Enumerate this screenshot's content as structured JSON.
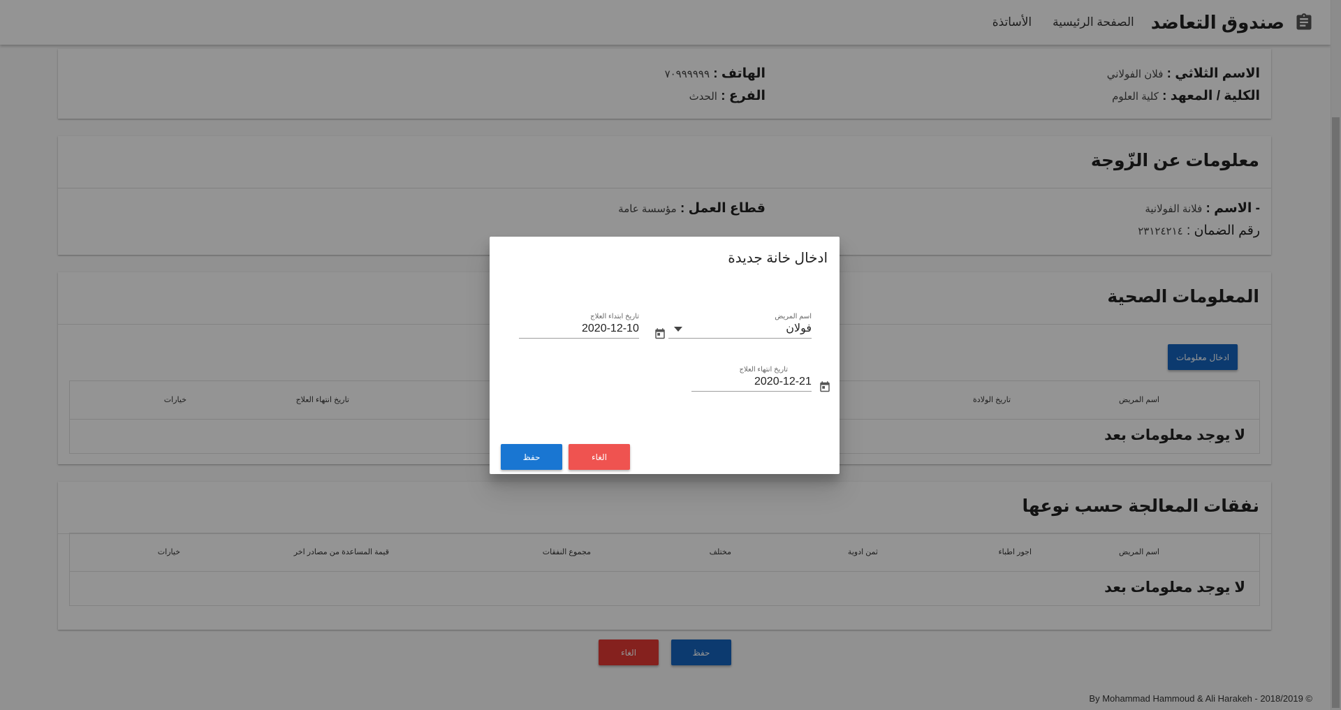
{
  "appbar": {
    "brand": "صندوق التعاضد",
    "nav": [
      "الصفحة الرئيسية",
      "الأساتذة"
    ]
  },
  "profile": {
    "name_label": "الاسم الثلاثي : ",
    "name_value": "فلان الفولاني",
    "faculty_label": "الكلية / المعهد : ",
    "faculty_value": "كلية العلوم",
    "phone_label": "الهاتف : ",
    "phone_value": "٧٠٩٩٩٩٩٩",
    "branch_label": "الفرع : ",
    "branch_value": "الحدث"
  },
  "spouse": {
    "title": "معلومات عن الزّوجة",
    "name_label": "- الاسم : ",
    "name_value": "فلانة الفولانية",
    "sector_label": "قطاع العمل : ",
    "sector_value": "مؤسسة عامة",
    "insurance_label": "رقم الضمان : ",
    "insurance_value": "٢٣١٢٤٢١٤"
  },
  "health": {
    "title": "المعلومات الصحية",
    "add_button": "ادخال معلومات",
    "columns": [
      "اسم المريض",
      "تاريخ الولادة",
      "تاريخ انتهاء العلاج",
      "خيارات"
    ],
    "empty": "لا يوجد معلومات بعد"
  },
  "expenses": {
    "title": "نفقات المعالجة حسب نوعها",
    "columns": [
      "اسم المريض",
      "اجور اطباء",
      "ثمن ادوية",
      "مختلف",
      "مجموع النفقات",
      "قيمة المساعدة من مصادر اخر",
      "خيارات"
    ],
    "empty": "لا يوجد معلومات بعد"
  },
  "page_buttons": {
    "save": "حفظ",
    "cancel": "الغاء"
  },
  "dialog": {
    "title": "ادخال خانة جديدة",
    "patient_label": "اسم المريض",
    "patient_value": "فولان",
    "start_label": "تاريخ ابتداء العلاج",
    "start_value": "2020-12-10",
    "end_label": "تاريخ انتهاء العلاج",
    "end_value": "2020-12-21",
    "save": "حفظ",
    "cancel": "الغاء"
  },
  "footer": "By Mohammad Hammoud & Ali Harakeh - 2018/2019 ©"
}
